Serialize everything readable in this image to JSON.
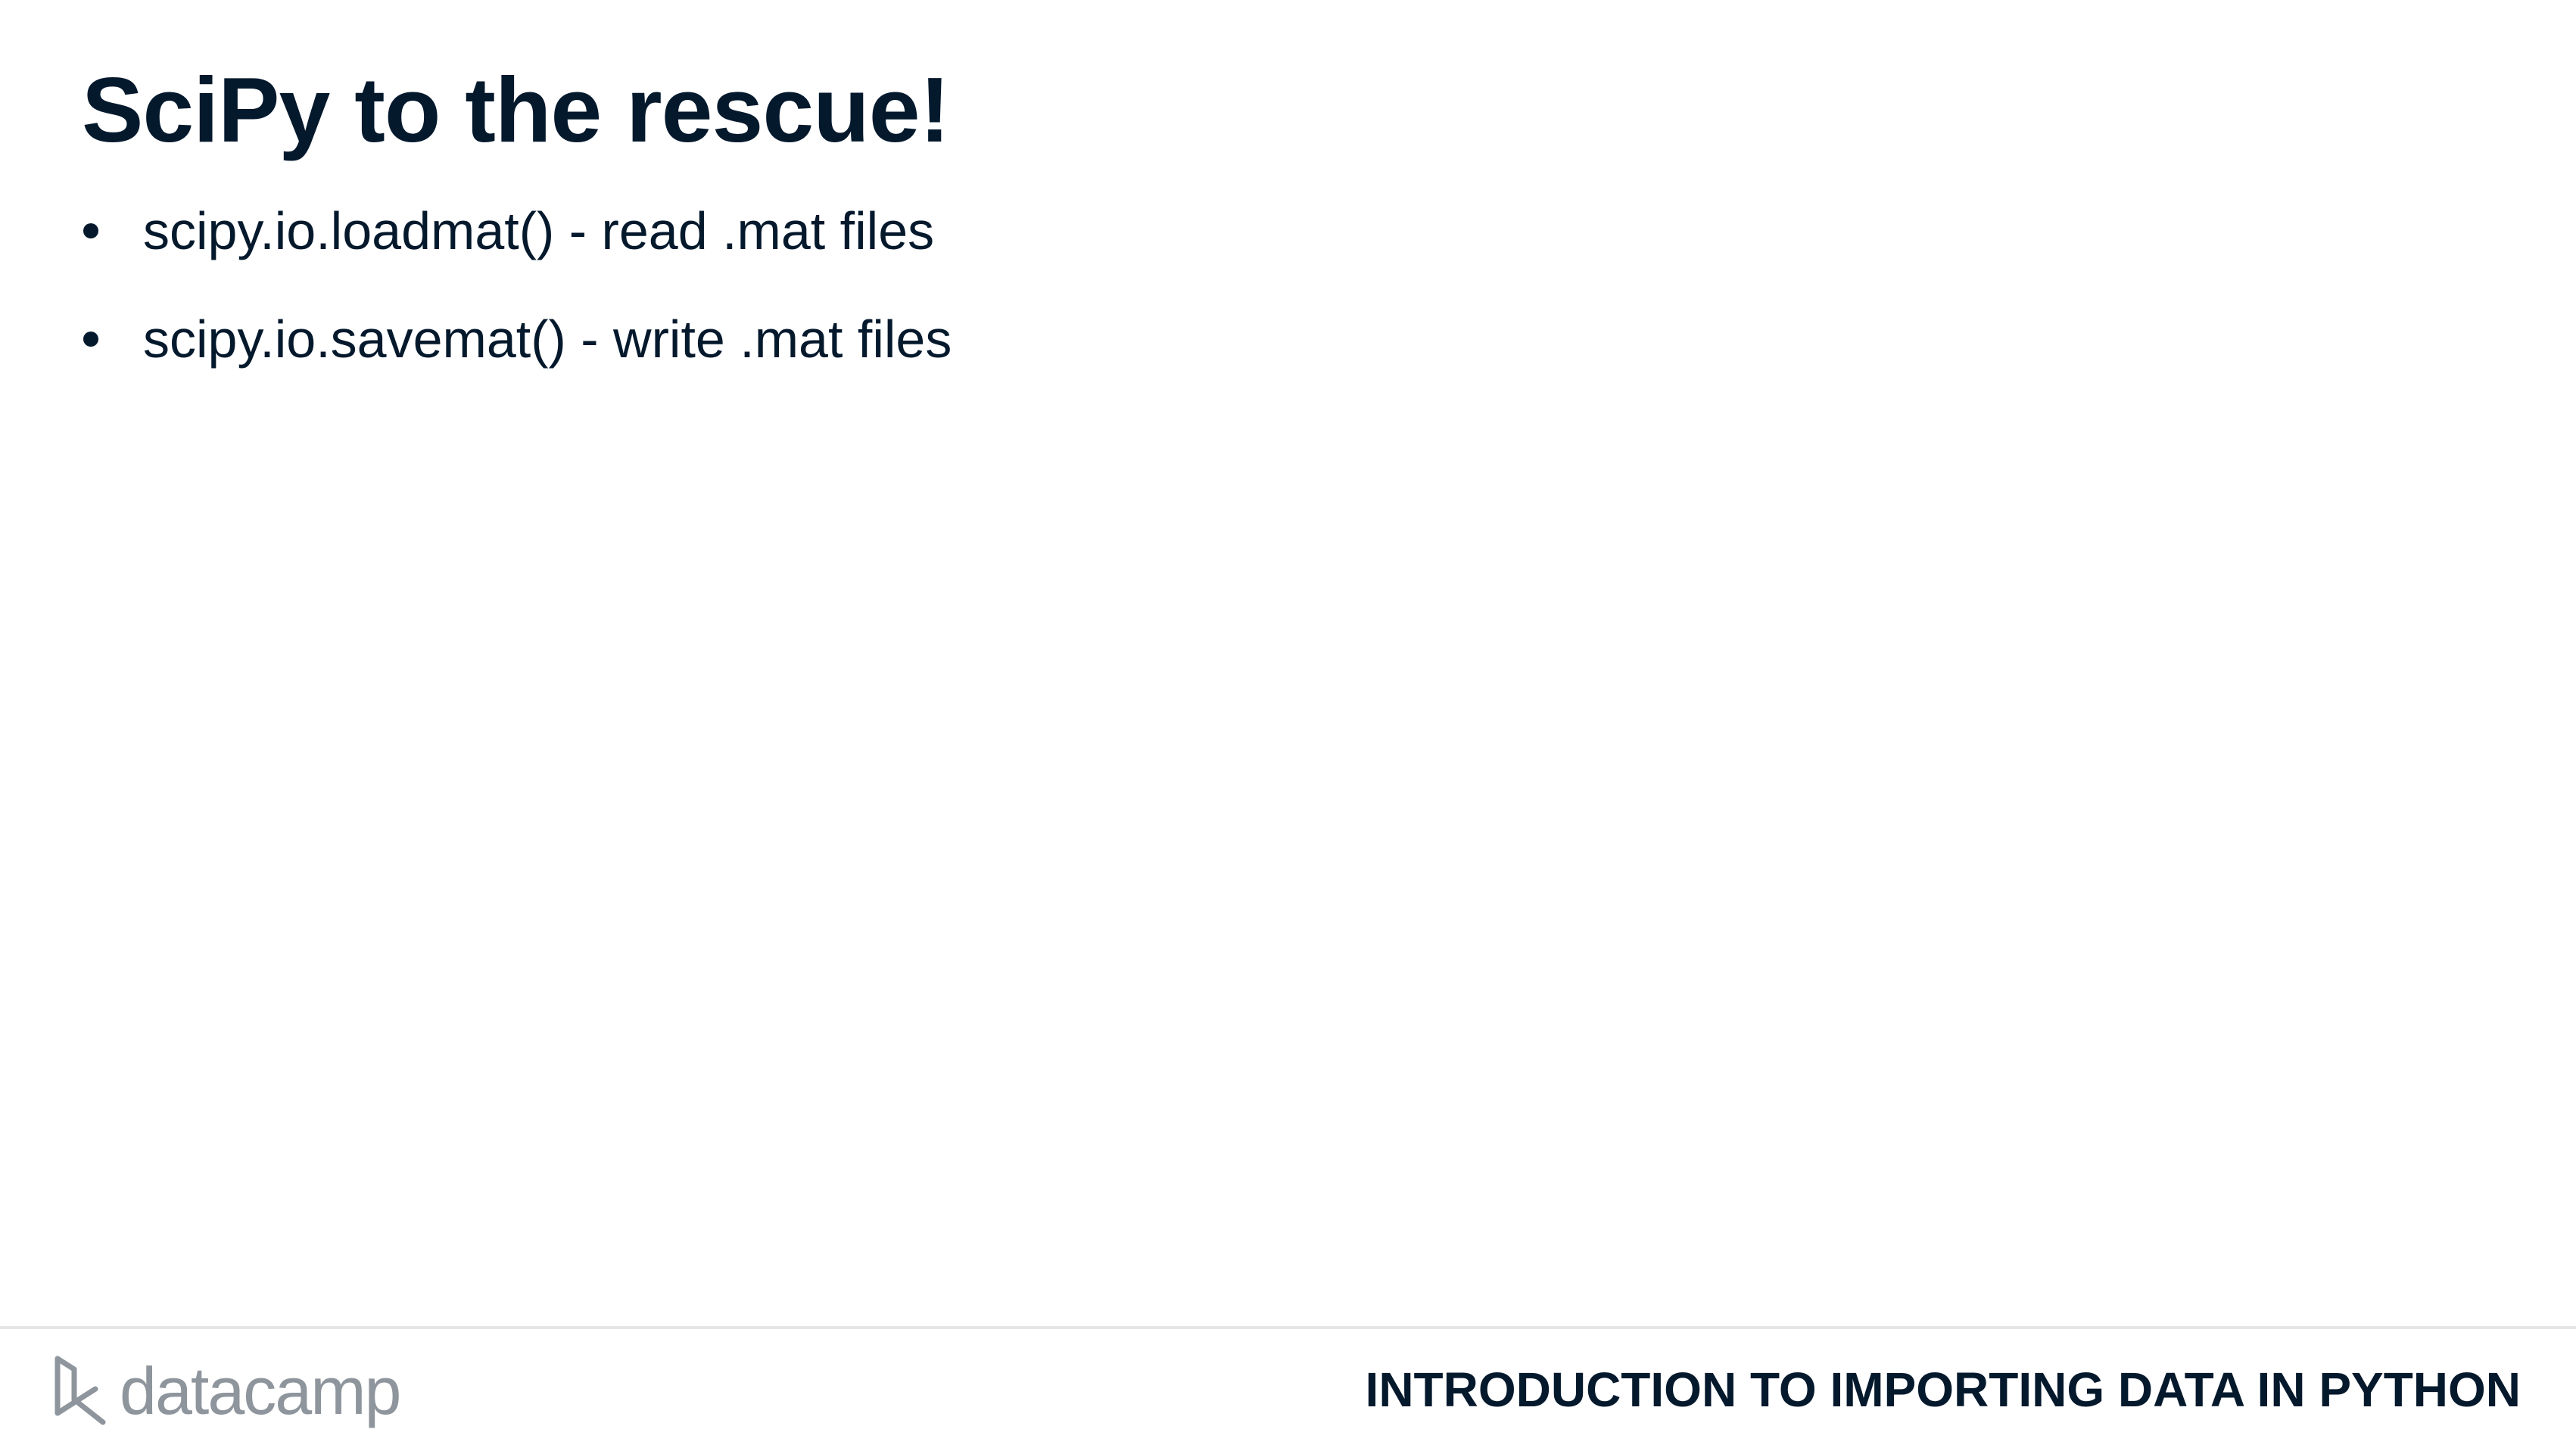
{
  "slide": {
    "title": "SciPy to the rescue!",
    "bullets": [
      {
        "text": "scipy.io.loadmat() - read .mat files"
      },
      {
        "text": "scipy.io.savemat() - write .mat files"
      }
    ]
  },
  "footer": {
    "logo_text": "datacamp",
    "logo_icon": "datacamp-logo-icon",
    "course_name": "INTRODUCTION TO IMPORTING DATA IN PYTHON"
  },
  "colors": {
    "text": "#05192d",
    "logo": "#8e959c",
    "divider": "#e4e6e8",
    "background": "#ffffff"
  }
}
